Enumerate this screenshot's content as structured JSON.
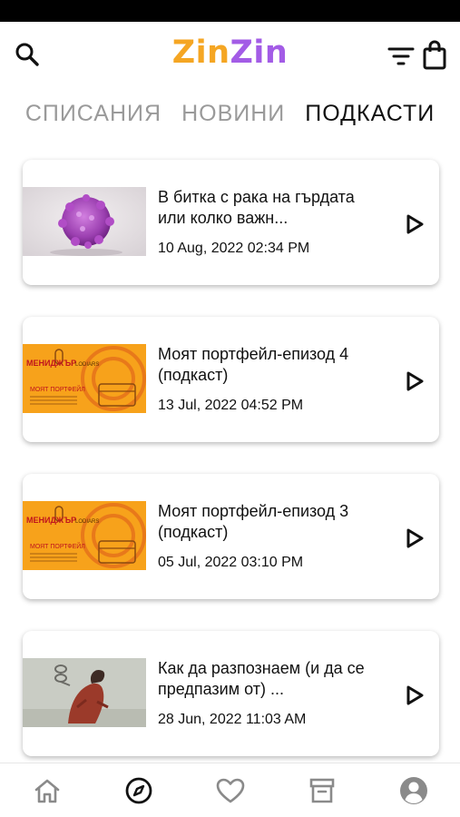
{
  "app": {
    "logo_part1": "Zin",
    "logo_part2": "Zin"
  },
  "icons": {
    "search": "search-icon",
    "filter": "filter-icon",
    "bag": "shopping-bag-icon",
    "play": "play-icon",
    "home": "home-icon",
    "explore": "compass-icon",
    "favorites": "heart-icon",
    "archive": "archive-box-icon",
    "profile": "user-avatar-icon"
  },
  "colors": {
    "logo_orange": "#f5a623",
    "logo_purple": "#a35ce6",
    "tab_inactive": "#9a9a9a",
    "tab_active": "#111111"
  },
  "tabs": [
    {
      "label": "СПИСАНИЯ",
      "active": false
    },
    {
      "label": "НОВИНИ",
      "active": false
    },
    {
      "label": "ПОДКАСТИ",
      "active": true
    }
  ],
  "podcasts": [
    {
      "title": "В битка с рака на гърдата или колко важн...",
      "date": "10 Aug, 2022 02:34 PM"
    },
    {
      "title": "Моят портфейл-епизод 4 (подкаст)",
      "date": "13 Jul, 2022 04:52 PM"
    },
    {
      "title": "Моят портфейл-епизод 3 (подкаст)",
      "date": "05 Jul, 2022 03:10 PM"
    },
    {
      "title": "Как да разпознаем (и да се предпазим от) ...",
      "date": "28 Jun, 2022 11:03 AM"
    }
  ],
  "thumb_text": {
    "brand": "МЕНИДЖЪР",
    "studio": "LODIARS",
    "show": "МОЯТ ПОРТФЕЙЛ"
  },
  "bottom_nav": {
    "active": "explore"
  }
}
